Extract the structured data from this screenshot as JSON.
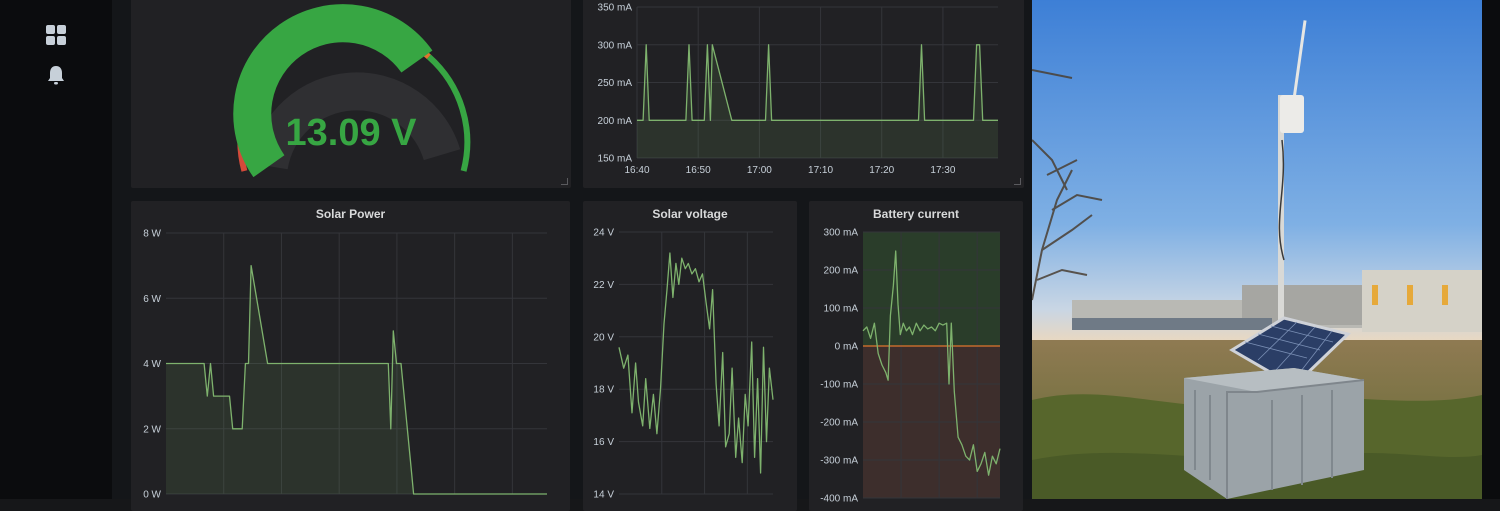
{
  "sidebar": {
    "items": [
      {
        "name": "dashboards",
        "icon": "dashboard-grid-icon"
      },
      {
        "name": "alerting",
        "icon": "bell-icon"
      }
    ]
  },
  "colors": {
    "green": "#37a643",
    "line": "#7eb26d",
    "orange": "#e0752d",
    "red": "#d44a3a",
    "panel": "#212124"
  },
  "battery_gauge": {
    "value_text": "13.09 V",
    "thresholds": {
      "min": 11,
      "max": 14.5,
      "green_from": 12,
      "orange_from": 14.0
    }
  },
  "charts": {
    "solar_current": {
      "type": "line",
      "title": "",
      "y_ticks": [
        "150 mA",
        "200 mA",
        "250 mA",
        "300 mA",
        "350 mA"
      ],
      "ylim": [
        150,
        350
      ],
      "x_ticks": [
        "16:40",
        "16:50",
        "17:00",
        "17:10",
        "17:20",
        "17:30"
      ],
      "x_tick_minutes": [
        0,
        10,
        20,
        30,
        40,
        50
      ],
      "xlim": [
        0,
        59
      ],
      "fill": true,
      "points": [
        [
          0,
          200
        ],
        [
          1,
          200
        ],
        [
          1.5,
          300
        ],
        [
          2,
          200
        ],
        [
          8,
          200
        ],
        [
          8.5,
          300
        ],
        [
          9,
          200
        ],
        [
          11,
          200
        ],
        [
          11.5,
          300
        ],
        [
          12,
          200
        ],
        [
          12.3,
          300
        ],
        [
          15.5,
          200
        ],
        [
          20,
          200
        ],
        [
          21,
          200
        ],
        [
          21.5,
          300
        ],
        [
          22,
          200
        ],
        [
          45,
          200
        ],
        [
          46,
          200
        ],
        [
          46.5,
          300
        ],
        [
          47,
          200
        ],
        [
          55,
          200
        ],
        [
          55.5,
          300
        ],
        [
          56,
          300
        ],
        [
          56.5,
          200
        ],
        [
          59,
          200
        ]
      ]
    },
    "solar_power": {
      "type": "line",
      "title": "Solar Power",
      "y_ticks": [
        "0 W",
        "2 W",
        "4 W",
        "6 W",
        "8 W"
      ],
      "ylim": [
        0,
        8
      ],
      "x_grid": 6,
      "fill": true,
      "points": [
        [
          0,
          4
        ],
        [
          6,
          4
        ],
        [
          6.5,
          3
        ],
        [
          7,
          4
        ],
        [
          7.5,
          3
        ],
        [
          10,
          3
        ],
        [
          10.5,
          2
        ],
        [
          12,
          2
        ],
        [
          12.5,
          4
        ],
        [
          13,
          4
        ],
        [
          13.4,
          7
        ],
        [
          16,
          4
        ],
        [
          35,
          4
        ],
        [
          35.4,
          2
        ],
        [
          35.8,
          5
        ],
        [
          36.3,
          4
        ],
        [
          37,
          4
        ],
        [
          38.5,
          1
        ],
        [
          39,
          0
        ],
        [
          60,
          0
        ]
      ]
    },
    "solar_voltage": {
      "type": "line",
      "title": "Solar voltage",
      "y_ticks": [
        "14 V",
        "16 V",
        "18 V",
        "20 V",
        "22 V",
        "24 V"
      ],
      "ylim": [
        14,
        24
      ],
      "x_grid": 3,
      "fill": false,
      "points": [
        [
          0,
          19.6
        ],
        [
          0.8,
          18.8
        ],
        [
          1.5,
          19.3
        ],
        [
          2.2,
          17.1
        ],
        [
          2.8,
          19
        ],
        [
          3.3,
          17.5
        ],
        [
          4,
          16.6
        ],
        [
          4.5,
          18.4
        ],
        [
          5.2,
          16.5
        ],
        [
          5.8,
          17.8
        ],
        [
          6.4,
          16.3
        ],
        [
          7,
          18
        ],
        [
          7.6,
          20.5
        ],
        [
          8.1,
          21.8
        ],
        [
          8.6,
          23.2
        ],
        [
          9.1,
          21.5
        ],
        [
          9.6,
          22.8
        ],
        [
          10.1,
          22
        ],
        [
          10.6,
          23
        ],
        [
          11.2,
          22.6
        ],
        [
          11.7,
          22.8
        ],
        [
          12.3,
          22.4
        ],
        [
          12.9,
          22.6
        ],
        [
          13.5,
          22.1
        ],
        [
          14.1,
          22.4
        ],
        [
          14.7,
          21.3
        ],
        [
          15.3,
          20.3
        ],
        [
          15.8,
          21.8
        ],
        [
          16.4,
          18.2
        ],
        [
          16.9,
          16.6
        ],
        [
          17.5,
          19.4
        ],
        [
          18,
          15.8
        ],
        [
          18.6,
          16.3
        ],
        [
          19.1,
          18.8
        ],
        [
          19.7,
          15.4
        ],
        [
          20.2,
          16.9
        ],
        [
          20.8,
          15.2
        ],
        [
          21.3,
          17.8
        ],
        [
          21.8,
          16.6
        ],
        [
          22.4,
          19.8
        ],
        [
          22.9,
          15.4
        ],
        [
          23.4,
          18.4
        ],
        [
          23.9,
          14.8
        ],
        [
          24.4,
          19.6
        ],
        [
          24.9,
          16
        ],
        [
          25.4,
          18.8
        ],
        [
          26,
          17.6
        ]
      ]
    },
    "battery_current": {
      "type": "line",
      "title": "Battery current",
      "y_ticks": [
        "-400 mA",
        "-300 mA",
        "-200 mA",
        "-100 mA",
        "0 mA",
        "100 mA",
        "200 mA",
        "300 mA"
      ],
      "ylim": [
        -400,
        300
      ],
      "x_grid": 3,
      "fill": false,
      "threshold": 0,
      "points": [
        [
          0,
          40
        ],
        [
          1,
          50
        ],
        [
          2,
          20
        ],
        [
          3,
          60
        ],
        [
          4,
          -20
        ],
        [
          5,
          -50
        ],
        [
          6,
          -70
        ],
        [
          6.6,
          -90
        ],
        [
          7.2,
          80
        ],
        [
          8,
          160
        ],
        [
          8.6,
          250
        ],
        [
          9.2,
          110
        ],
        [
          9.8,
          30
        ],
        [
          10.6,
          60
        ],
        [
          11.4,
          40
        ],
        [
          12.2,
          50
        ],
        [
          13,
          30
        ],
        [
          14,
          60
        ],
        [
          15,
          40
        ],
        [
          16,
          55
        ],
        [
          17,
          45
        ],
        [
          18,
          50
        ],
        [
          19,
          40
        ],
        [
          20,
          60
        ],
        [
          21,
          55
        ],
        [
          22,
          60
        ],
        [
          22.6,
          -100
        ],
        [
          23.2,
          60
        ],
        [
          24,
          -120
        ],
        [
          25,
          -240
        ],
        [
          26,
          -260
        ],
        [
          27,
          -290
        ],
        [
          28,
          -300
        ],
        [
          29,
          -260
        ],
        [
          30,
          -330
        ],
        [
          31,
          -310
        ],
        [
          32,
          -280
        ],
        [
          33,
          -340
        ],
        [
          34,
          -290
        ],
        [
          35,
          -310
        ],
        [
          36,
          -270
        ]
      ]
    }
  }
}
